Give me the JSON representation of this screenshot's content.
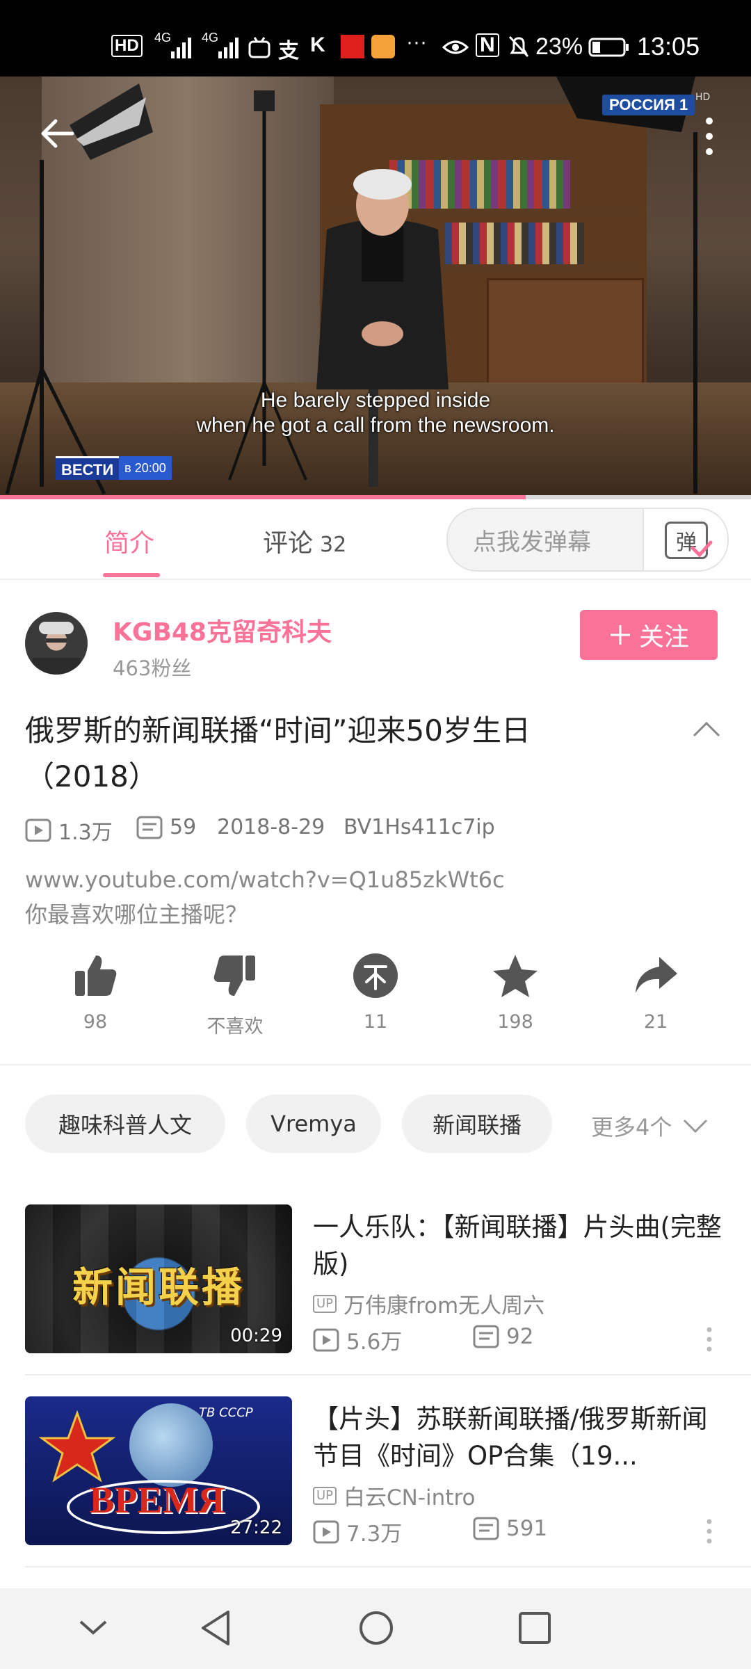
{
  "status_bar": {
    "hd_label": "HD",
    "net1": "4G",
    "net2": "4G",
    "more": "···",
    "nfc": "N",
    "battery": "23%",
    "time": "13:05"
  },
  "video": {
    "channel_logo": "РОССИЯ 1",
    "hd_label": "HD",
    "subtitle_line1": "He barely stepped inside",
    "subtitle_line2": "when he got a call from the newsroom.",
    "vesti_logo": "ВЕСТИ",
    "vesti_time": "в 20:00",
    "progress": 0.7
  },
  "tabs": {
    "intro": "简介",
    "comments": "评论",
    "comments_count": "32",
    "danmaku_placeholder": "点我发弹幕",
    "danmaku_icon_char": "弹"
  },
  "author": {
    "name": "KGB48克留奇科夫",
    "fans": "463粉丝",
    "follow_label": "关注"
  },
  "video_info": {
    "title": "俄罗斯的新闻联播“时间”迎来50岁生日（2018）",
    "views": "1.3万",
    "danmaku_count": "59",
    "date": "2018-8-29",
    "bvid": "BV1Hs411c7ip",
    "desc_line1": "www.youtube.com/watch?v=Q1u85zkWt6c",
    "desc_line2": "你最喜欢哪位主播呢？"
  },
  "actions": {
    "like": "98",
    "dislike": "不喜欢",
    "coin": "11",
    "favorite": "198",
    "share": "21"
  },
  "tags": {
    "items": [
      "趣味科普人文",
      "Vremya",
      "新闻联播"
    ],
    "more": "更多4个"
  },
  "recommendations": [
    {
      "thumb_text": "新闻联播",
      "duration": "00:29",
      "title": "一人乐队：【新闻联播】片头曲(完整版)",
      "up_badge": "UP",
      "uploader": "万伟康from无人周六",
      "views": "5.6万",
      "danmaku": "92"
    },
    {
      "thumb_text": "ВРЕМЯ",
      "thumb_corner": "ТВ СССР",
      "duration": "27:22",
      "title": "【片头】苏联新闻联播/俄罗斯新闻节目《时间》OP合集（19...",
      "up_badge": "UP",
      "uploader": "白云CN-intro",
      "views": "7.3万",
      "danmaku": "591"
    }
  ],
  "colors": {
    "accent": "#fb7299"
  }
}
